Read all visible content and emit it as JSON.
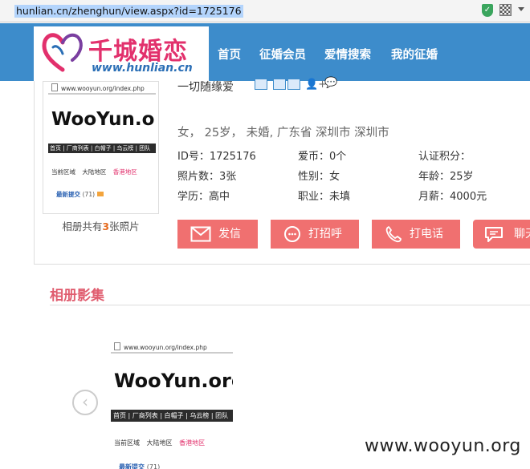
{
  "browser": {
    "url": "hunlian.cn/zhenghun/view.aspx?id=1725176"
  },
  "header": {
    "logo_text": "千城婚恋",
    "logo_domain": "www.hunlian.cn",
    "nav": [
      "首页",
      "征婚会员",
      "爱情搜索",
      "我的征婚"
    ]
  },
  "profile": {
    "motto": "一切随缘爱",
    "summary": "女， 25岁， 未婚, 广东省 深圳市 深圳市",
    "fields": [
      {
        "label": "ID号：",
        "value": "1725176"
      },
      {
        "label": "爱币：",
        "value": "0个"
      },
      {
        "label": "认证积分：",
        "value": ""
      },
      {
        "label": "照片数：",
        "value": "3张"
      },
      {
        "label": "性别：",
        "value": "女"
      },
      {
        "label": "年龄：",
        "value": "25岁"
      },
      {
        "label": "学历：",
        "value": "高中"
      },
      {
        "label": "职业：",
        "value": "未填"
      },
      {
        "label": "月薪：",
        "value": "4000元"
      }
    ],
    "album_count_prefix": "相册共有",
    "album_count_num": "3",
    "album_count_suffix": "张照片",
    "actions": [
      "发信",
      "打招呼",
      "打电话",
      "聊天"
    ]
  },
  "photo_screenshot": {
    "url": "www.wooyun.org/index.php",
    "logo": "WooYun.org",
    "menu": "首页 | 厂商列表 | 白帽子 | 乌云榜 | 团队",
    "tabs": [
      "当前区域",
      "大陆地区",
      "香港地区"
    ],
    "latest": "最新提交",
    "latest_count": "(71)"
  },
  "album": {
    "title": "相册影集",
    "prev_arrow": "‹"
  },
  "watermark": "www.wooyun.org",
  "colors": {
    "header_blue": "#3d8ccb",
    "button_red": "#f07070",
    "logo_pink": "#e2306c",
    "album_title": "#e05d6f"
  }
}
